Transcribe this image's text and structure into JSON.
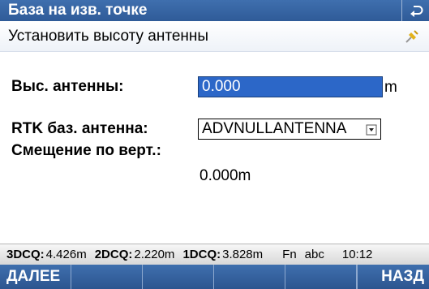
{
  "window": {
    "title": "База на изв. точке",
    "back_icon": "back-arrow-icon"
  },
  "header": {
    "subtitle": "Установить высоту антенны"
  },
  "form": {
    "antenna_height_label": "Выс. антенны:",
    "antenna_height_value": "0.000",
    "antenna_height_unit": "m",
    "rtk_antenna_label": "RTK баз. антенна:",
    "rtk_antenna_value": "ADVNULLANTENNA",
    "vertical_offset_label": "Смещение по верт.:",
    "vertical_offset_value": "0.000m"
  },
  "status": {
    "dcq3_key": "3DCQ:",
    "dcq3_val": "4.426m",
    "dcq2_key": "2DCQ:",
    "dcq2_val": "2.220m",
    "dcq1_key": "1DCQ:",
    "dcq1_val": "3.828m",
    "fn": "Fn",
    "input_mode": "abc",
    "time": "10:12"
  },
  "softkeys": [
    "ДАЛЕЕ",
    "",
    "",
    "",
    "",
    "НАЗД"
  ],
  "colors": {
    "bar": "#2f5b98",
    "selection": "#2c67c8"
  }
}
